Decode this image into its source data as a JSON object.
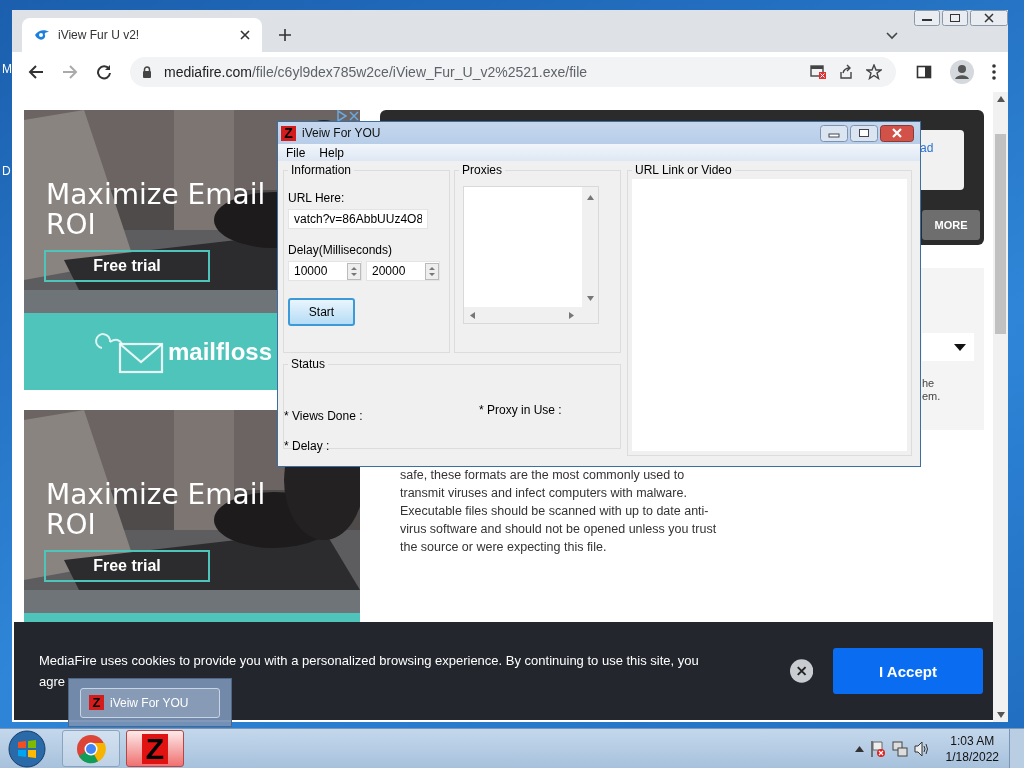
{
  "desktop": {
    "icon_labels": [
      "M",
      "D"
    ]
  },
  "browser": {
    "tab": {
      "title": "iView Fur U v2!",
      "selected": true
    },
    "address_host": "mediafire.com",
    "address_path": "/file/c6yl9dex785w2ce/iView_Fur_U_v2%2521.exe/file"
  },
  "ads": [
    {
      "headline": "Maximize Email ROI",
      "button": "Free trial",
      "brand": "mailfloss"
    },
    {
      "headline": "Maximize Email ROI",
      "button": "Free trial"
    }
  ],
  "download_card": {
    "link": "ad",
    "button": "MORE"
  },
  "info_panel": {
    "lines": [
      "he",
      "em."
    ]
  },
  "warning_text": "safe, these formats are the most commonly used to transmit viruses and infect computers with malware. Executable files should be scanned with up to date anti-virus software and should not be opened unless you trust the source or were expecting this file.",
  "cookie_bar": {
    "text": "MediaFire uses cookies to provide you with a personalized browsing experience. By continuing to use this site, you agre",
    "accept": "I Accept"
  },
  "app": {
    "icon": "Z",
    "title": "iVeiw For YOU",
    "menu": [
      "File",
      "Help"
    ],
    "information": {
      "title": "Information",
      "url_label": "URL Here:",
      "url_value": "vatch?v=86AbbUUz4O8",
      "delay_label": "Delay(Milliseconds)",
      "delay_min": "10000",
      "delay_max": "20000",
      "start": "Start"
    },
    "proxies": {
      "title": "Proxies"
    },
    "video": {
      "title": "URL Link or Video"
    },
    "status": {
      "title": "Status",
      "views_done": "* Views Done :",
      "proxy_in_use": "* Proxy in Use :",
      "delay": "* Delay :"
    }
  },
  "taskbar": {
    "thumbnail": {
      "icon": "Z",
      "title": "iVeiw For YOU"
    },
    "buttons": [
      {
        "kind": "chrome",
        "selected": false
      },
      {
        "kind": "app",
        "icon": "Z",
        "selected": true
      }
    ],
    "time": "1:03 AM",
    "date": "1/18/2022"
  }
}
